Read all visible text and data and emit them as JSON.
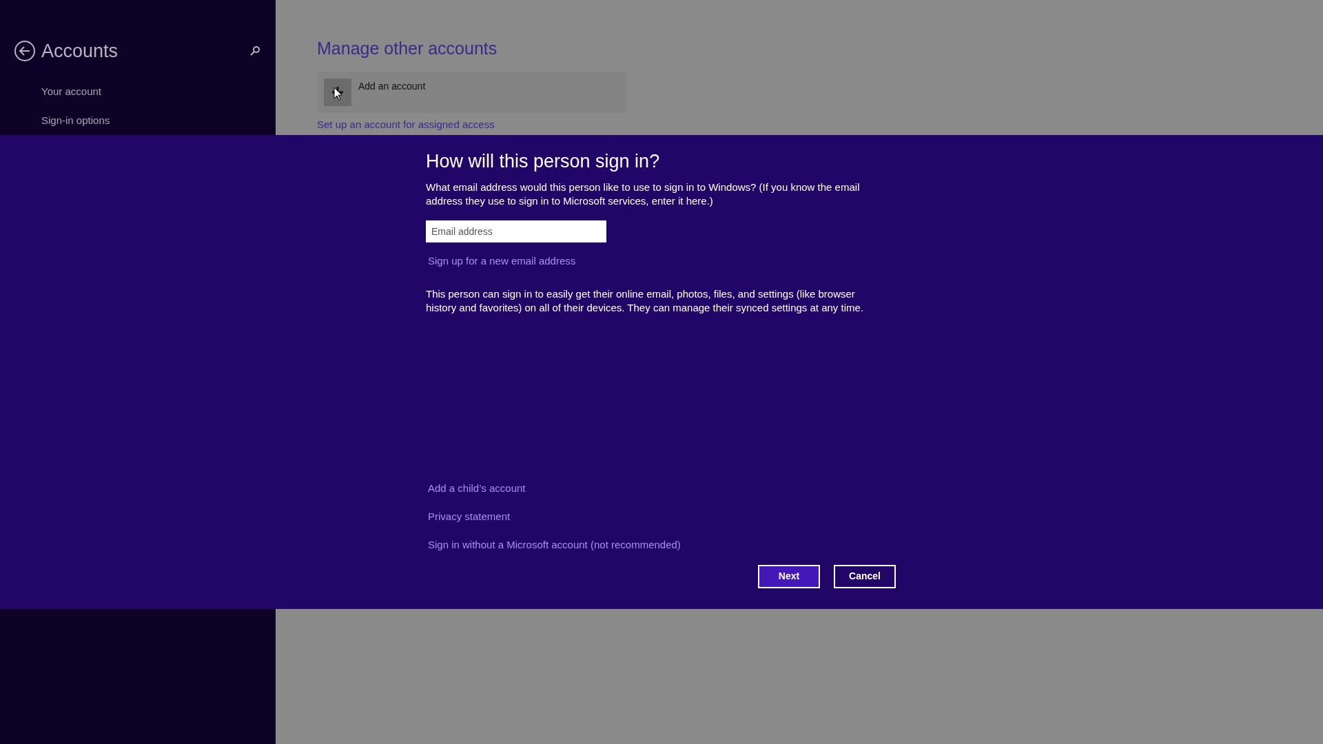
{
  "sidebar": {
    "title": "Accounts",
    "items": [
      {
        "label": "Your account"
      },
      {
        "label": "Sign-in options"
      }
    ]
  },
  "main": {
    "title": "Manage other accounts",
    "add_tile": {
      "label": "Add an account"
    },
    "link": "Set up an account for assigned access"
  },
  "dialog": {
    "title": "How will this person sign in?",
    "intro": "What email address would this person like to use to sign in to Windows? (If you know the email address they use to sign in to Microsoft services, enter it here.)",
    "email_field": {
      "placeholder": "Email address"
    },
    "signup_link": "Sign up for a new email address",
    "info": "This person can sign in to easily get their online email, photos, files, and settings (like browser history and favorites) on all of their devices. They can manage their synced settings at any time.",
    "links": [
      "Add a child’s account",
      "Privacy statement",
      "Sign in without a Microsoft account (not recommended)"
    ],
    "buttons": [
      {
        "label": "Next",
        "kind": "primary"
      },
      {
        "label": "Cancel",
        "kind": "secondary"
      }
    ]
  }
}
